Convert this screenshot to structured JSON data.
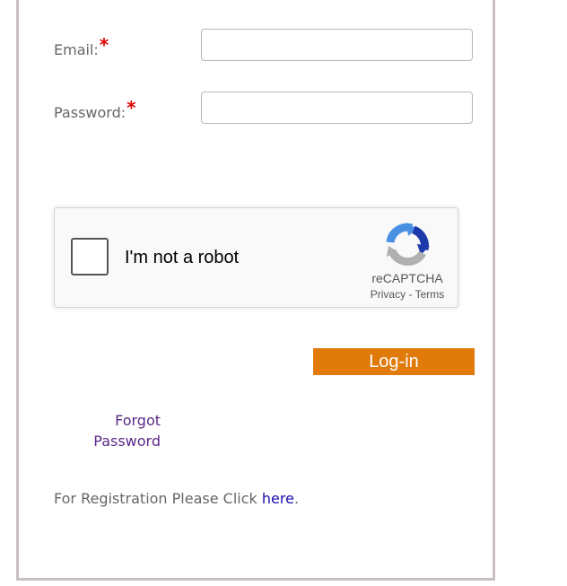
{
  "form": {
    "email_label": "Email:",
    "email_required_mark": "*",
    "email_value": "",
    "password_label": "Password:",
    "password_required_mark": "*",
    "password_value": ""
  },
  "recaptcha": {
    "checkbox_label": "I'm not a robot",
    "brand": "reCAPTCHA",
    "privacy_link": "Privacy",
    "separator": " - ",
    "terms_link": "Terms",
    "logo_icon": "recaptcha-logo-icon",
    "colors": {
      "blue": "#4a90e2",
      "dark_blue": "#1c3aa9",
      "gray": "#b0b0b0"
    }
  },
  "login_button": {
    "label": "Log-in",
    "color": "#e07a0b"
  },
  "forgot_password": {
    "line1": "Forgot",
    "line2": "Password"
  },
  "registration": {
    "prefix": "For Registration Please Click ",
    "link": "here",
    "suffix": "."
  }
}
